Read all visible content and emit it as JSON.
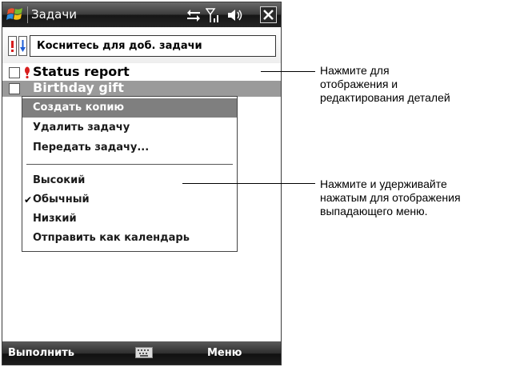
{
  "titlebar": {
    "title": "Задачи",
    "icons": [
      "windows-logo-icon",
      "connectivity-icon",
      "signal-icon",
      "volume-icon",
      "close-icon"
    ]
  },
  "sortbar": {
    "entry_placeholder": "Коснитесь для доб. задачи",
    "icons": [
      "priority-sort-icon",
      "arrow-down-sort-icon"
    ]
  },
  "tasks": [
    {
      "title": "Status report",
      "priority": "high",
      "checked": false
    },
    {
      "title": "Birthday gift",
      "priority": "normal",
      "checked": false
    }
  ],
  "context_menu": {
    "items": [
      {
        "label": "Создать копию"
      },
      {
        "label": "Удалить задачу"
      },
      {
        "label": "Передать задачу..."
      }
    ],
    "priority_items": [
      {
        "label": "Высокий"
      },
      {
        "label": "Обычный"
      },
      {
        "label": "Низкий"
      },
      {
        "label": "Отправить как календарь"
      }
    ],
    "checked_item": "Обычный",
    "highlighted_item": "Создать копию"
  },
  "softkeys": {
    "left": "Выполнить",
    "right": "Меню",
    "center_icon": "keyboard-icon"
  },
  "callouts": [
    {
      "lines": [
        "Нажмите для",
        "отображения и",
        "редактирования деталей"
      ]
    },
    {
      "lines": [
        "Нажмите и удерживайте",
        "нажатым для отображения",
        "выпадающего меню."
      ]
    }
  ]
}
